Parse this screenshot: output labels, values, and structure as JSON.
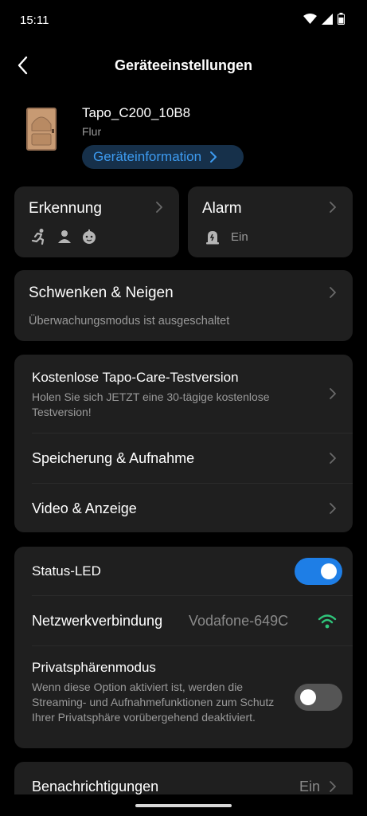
{
  "status_bar": {
    "time": "15:11"
  },
  "header": {
    "title": "Geräteeinstellungen"
  },
  "device": {
    "name": "Tapo_C200_10B8",
    "location": "Flur",
    "info_button": "Geräteinformation"
  },
  "detection_card": {
    "title": "Erkennung",
    "icons": [
      "running-person-icon",
      "person-icon",
      "baby-face-icon"
    ]
  },
  "alarm_card": {
    "title": "Alarm",
    "status": "Ein"
  },
  "pan_tilt": {
    "title": "Schwenken & Neigen",
    "subtitle": "Überwachungsmodus ist ausgeschaltet"
  },
  "services": [
    {
      "title": "Kostenlose Tapo-Care-Testversion",
      "subtitle": "Holen Sie sich JETZT eine 30-tägige kostenlose Testversion!"
    },
    {
      "title": "Speicherung & Aufnahme"
    },
    {
      "title": "Video & Anzeige"
    }
  ],
  "settings": {
    "status_led": {
      "label": "Status-LED",
      "on": true
    },
    "network": {
      "label": "Netzwerkverbindung",
      "value": "Vodafone-649C"
    },
    "privacy": {
      "label": "Privatsphärenmodus",
      "description": "Wenn diese Option aktiviert ist, werden die Streaming- und Aufnahmefunktionen zum Schutz Ihrer Privatsphäre vorübergehend deaktiviert.",
      "on": false
    }
  },
  "notifications": {
    "label": "Benachrichtigungen",
    "value": "Ein"
  },
  "colors": {
    "accent": "#1e7ee6",
    "wifi": "#2fc47a",
    "card": "#1f1f1f",
    "background": "#000000"
  }
}
